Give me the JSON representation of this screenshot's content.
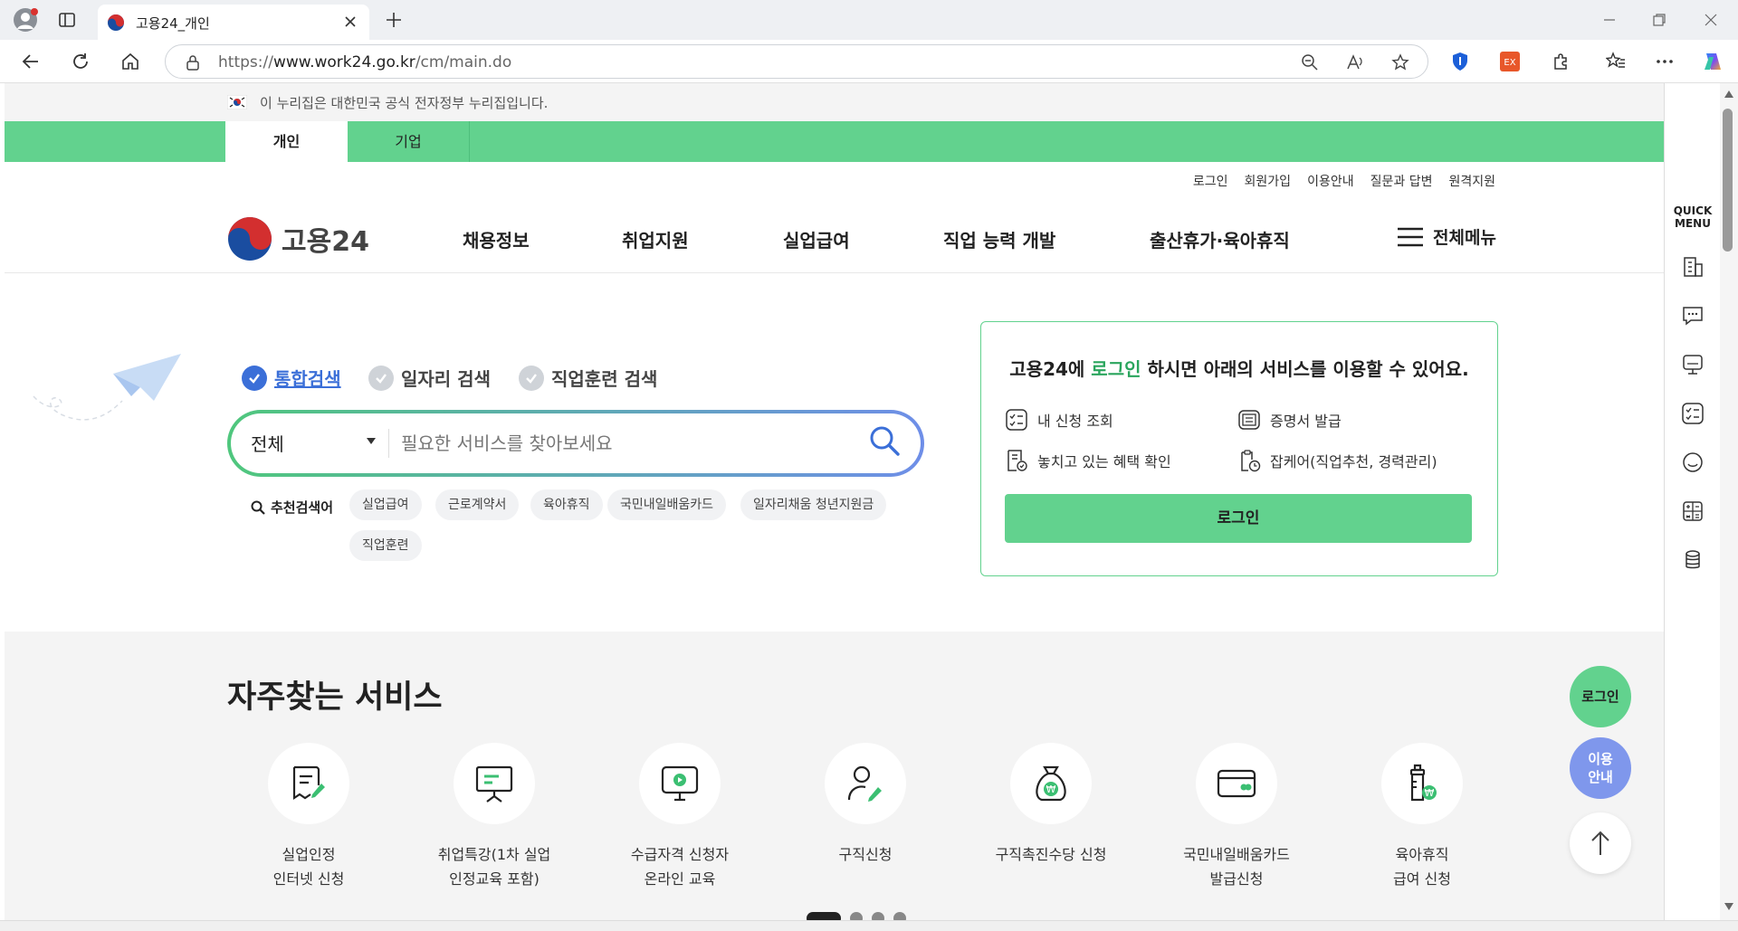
{
  "browser": {
    "tab_title": "고용24_개인",
    "url_scheme": "https://",
    "url_domain": "www.work24.go.kr",
    "url_path": "/cm/main.do",
    "extension_badge": "EX"
  },
  "gov_banner": {
    "text": "이 누리집은 대한민국 공식 전자정부 누리집입니다."
  },
  "category_tabs": [
    {
      "label": "개인"
    },
    {
      "label": "기업"
    }
  ],
  "utility_links": [
    "로그인",
    "회원가입",
    "이용안내",
    "질문과 답변",
    "원격지원"
  ],
  "logo": {
    "text": "고용24"
  },
  "gnb": [
    "채용정보",
    "취업지원",
    "실업급여",
    "직업 능력 개발",
    "출산휴가·육아휴직"
  ],
  "all_menu": "전체메뉴",
  "search": {
    "types": [
      "통합검색",
      "일자리 검색",
      "직업훈련 검색"
    ],
    "scope": "전체",
    "placeholder": "필요한 서비스를 찾아보세요",
    "recommend_label": "추천검색어",
    "keywords": [
      "실업급여",
      "근로계약서",
      "육아휴직",
      "국민내일배움카드",
      "일자리채움 청년지원금",
      "직업훈련"
    ]
  },
  "login_box": {
    "title_prefix": "고용24에 ",
    "title_highlight": "로그인",
    "title_suffix": " 하시면 아래의 서비스를 이용할 수 있어요.",
    "services": [
      "내 신청 조회",
      "증명서 발급",
      "놓치고 있는 혜택 확인",
      "잡케어(직업추천, 경력관리)"
    ],
    "button": "로그인",
    "accent": "#62d28e"
  },
  "frequent": {
    "title": "자주찾는 서비스",
    "items": [
      {
        "line1": "실업인정",
        "line2": "인터넷 신청",
        "icon": "document-pen-icon"
      },
      {
        "line1": "취업특강(1차 실업",
        "line2": "인정교육 포함)",
        "icon": "presentation-board-icon"
      },
      {
        "line1": "수급자격 신청자",
        "line2": "온라인 교육",
        "icon": "monitor-play-icon"
      },
      {
        "line1": "구직신청",
        "line2": "",
        "icon": "person-pen-icon"
      },
      {
        "line1": "구직촉진수당 신청",
        "line2": "",
        "icon": "money-bag-icon"
      },
      {
        "line1": "국민내일배움카드",
        "line2": "발급신청",
        "icon": "card-icon"
      },
      {
        "line1": "육아휴직",
        "line2": "급여 신청",
        "icon": "baby-bottle-icon"
      }
    ],
    "slides": 4,
    "active_slide": 1
  },
  "floating": {
    "login": "로그인",
    "guide_line1": "이용",
    "guide_line2": "안내"
  },
  "quick_menu": {
    "title_line1": "QUICK",
    "title_line2": "MENU"
  }
}
